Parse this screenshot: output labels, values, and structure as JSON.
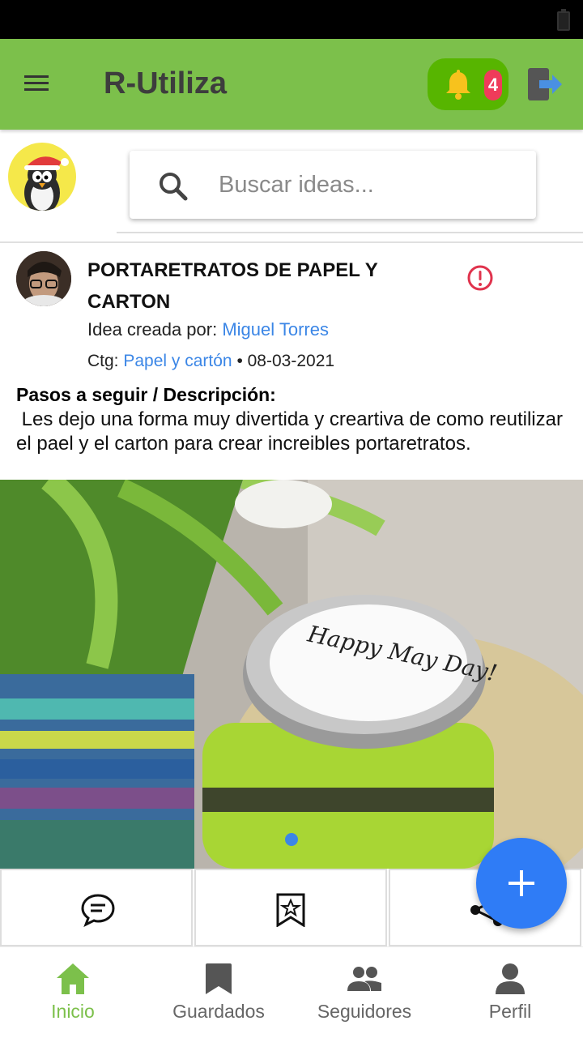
{
  "app_bar": {
    "title": "R-Utiliza",
    "notification_count": "4",
    "accent_color": "#7cc04b",
    "icons": [
      "menu-icon",
      "bell-icon",
      "logout-icon"
    ]
  },
  "search": {
    "placeholder": "Buscar ideas..."
  },
  "post": {
    "title": "PORTARETRATOS DE PAPEL Y CARTON",
    "creator_prefix": "Idea creada por: ",
    "creator_name": "Miguel Torres",
    "category_prefix": "Ctg: ",
    "category": "Papel y cartón",
    "date": " • 08-03-2021",
    "description_heading": "Pasos a seguir / Descripción:",
    "description": " Les dejo una forma muy divertida y creartiva de como reutilizar el pael y el carton para crear increibles portaretratos.",
    "image_text": "Happy May Day!"
  },
  "actions": [
    "comment-icon",
    "bookmark-star-icon",
    "share-icon"
  ],
  "bottom_nav": [
    {
      "label": "Inicio",
      "icon": "home-icon",
      "active": true
    },
    {
      "label": "Guardados",
      "icon": "bookmark-icon",
      "active": false
    },
    {
      "label": "Seguidores",
      "icon": "people-icon",
      "active": false
    },
    {
      "label": "Perfil",
      "icon": "person-icon",
      "active": false
    }
  ]
}
